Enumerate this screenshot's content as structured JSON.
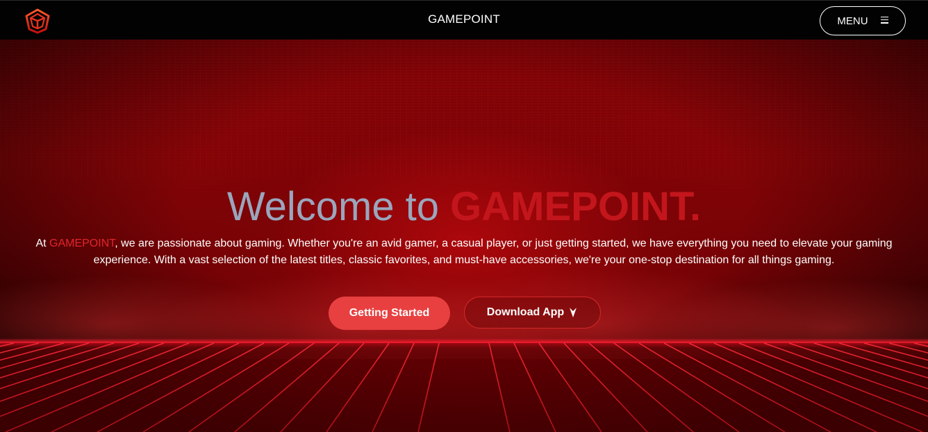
{
  "header": {
    "brand": "GAMEPOINT",
    "menu_label": "MENU",
    "logo_icon": "triangle-emblem-icon",
    "menu_icon": "hamburger-icon"
  },
  "hero": {
    "title_prefix": "Welcome to ",
    "title_brand": "GAMEPOINT.",
    "intro_lead": "At ",
    "intro_brand": "GAMEPOINT",
    "intro_text": ", we are passionate about gaming. Whether you're an avid gamer, a casual player, or just getting started, we have everything you need to elevate your gaming experience. With a vast selection of the latest titles, classic favorites, and must-have accessories, we're your one-stop destination for all things gaming.",
    "primary_button": "Getting Started",
    "secondary_button": "Download App",
    "secondary_icon": "arrow-down-icon"
  },
  "colors": {
    "accent": "#c3161c",
    "button": "#e84040",
    "title_gray": "#9aa6bd",
    "background": "#000000"
  }
}
